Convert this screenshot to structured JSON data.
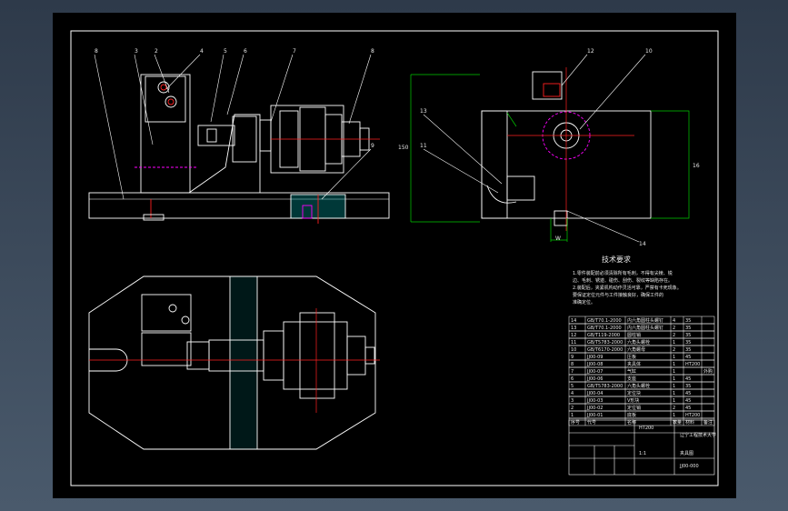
{
  "colors": {
    "background": "#000000",
    "outline": "#ffffff",
    "centerline": "#ff2020",
    "hidden": "#ff00ff",
    "dimension": "#00cc00",
    "section_fill": "#00a0a0",
    "frame_outer": "#2e3a4a"
  },
  "drawing": {
    "top_view_callouts": [
      "8",
      "3",
      "2",
      "4",
      "5",
      "6",
      "7",
      "8",
      "9"
    ],
    "side_view_callouts": [
      "12",
      "10",
      "13",
      "11",
      "14"
    ],
    "dims": [
      "150",
      "16",
      "W"
    ],
    "notes_title": "技术要求",
    "notes_lines": [
      "1.零件装配前必须清除所有毛刺，不得有尖棱、锐",
      "边、毛刺、锈迹、碰伤、刮伤、裂纹等缺陷存在。",
      "2.装配后，夹紧机构动作灵活可靠，严禁有卡死现象。",
      "要保证定位元件与工件接触良好，确保工件的",
      "准确定位。"
    ]
  },
  "title_block": {
    "school": "辽宁工程技术大学",
    "drawing_name": "夹具图",
    "drawing_no": "JJ00-000",
    "scale": "1:1",
    "material": "HT200"
  },
  "parts_list": {
    "headers": [
      "序号",
      "代号",
      "名称",
      "数量",
      "材料",
      "备注"
    ],
    "rows": [
      [
        "14",
        "GB/T70.1-2000",
        "内六角圆柱头螺钉",
        "4",
        "35",
        ""
      ],
      [
        "13",
        "GB/T70.1-2000",
        "内六角圆柱头螺钉",
        "2",
        "35",
        ""
      ],
      [
        "12",
        "GB/T119-2000",
        "圆柱销",
        "2",
        "35",
        ""
      ],
      [
        "11",
        "GB/T5783-2000",
        "六角头螺栓",
        "1",
        "35",
        ""
      ],
      [
        "10",
        "GB/T6170-2000",
        "六角螺母",
        "2",
        "35",
        ""
      ],
      [
        "9",
        "JJ00-09",
        "压板",
        "1",
        "45",
        ""
      ],
      [
        "8",
        "JJ00-08",
        "夹具体",
        "1",
        "HT200",
        ""
      ],
      [
        "7",
        "JJ00-07",
        "气缸",
        "1",
        "",
        "外购"
      ],
      [
        "6",
        "JJ00-06",
        "支座",
        "1",
        "45",
        ""
      ],
      [
        "5",
        "GB/T5783-2000",
        "六角头螺栓",
        "1",
        "35",
        ""
      ],
      [
        "4",
        "JJ00-04",
        "定位块",
        "1",
        "45",
        ""
      ],
      [
        "3",
        "JJ00-03",
        "V形块",
        "1",
        "45",
        ""
      ],
      [
        "2",
        "JJ00-02",
        "定位销",
        "2",
        "45",
        ""
      ],
      [
        "1",
        "JJ00-01",
        "底板",
        "1",
        "HT200",
        ""
      ]
    ]
  }
}
